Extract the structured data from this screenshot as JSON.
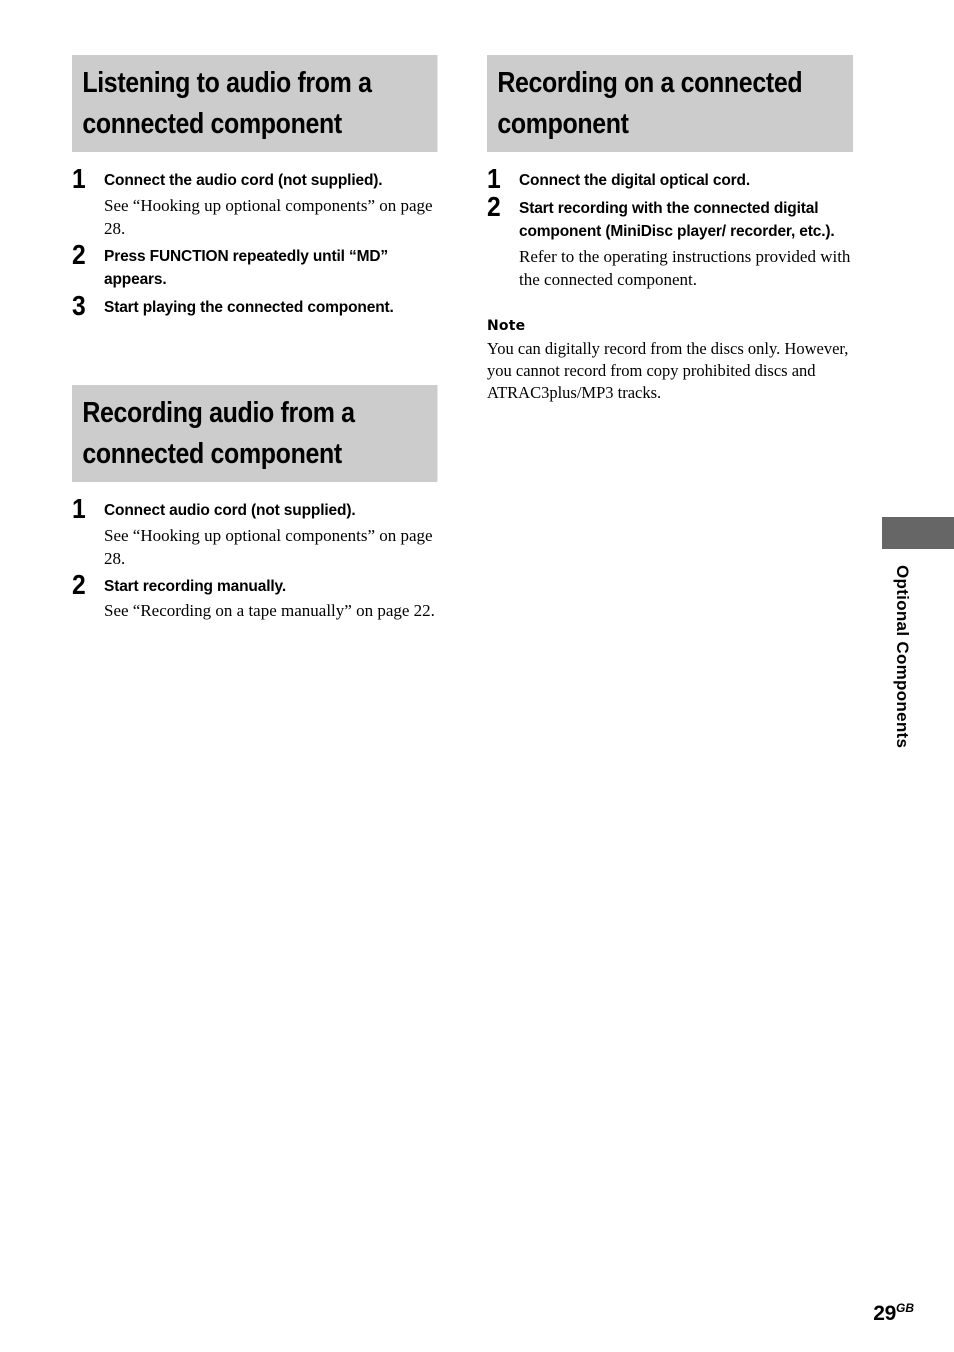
{
  "page": {
    "number": "29",
    "region_code": "GB",
    "side_tab_label": "Optional Components"
  },
  "left_column": {
    "sections": [
      {
        "heading": "Listening to audio from a connected component",
        "steps": [
          {
            "number": "1",
            "title": "Connect the audio cord (not supplied).",
            "body": "See “Hooking up optional components” on page 28."
          },
          {
            "number": "2",
            "title": "Press FUNCTION repeatedly until “MD” appears.",
            "body": ""
          },
          {
            "number": "3",
            "title": "Start playing the connected component.",
            "body": ""
          }
        ]
      },
      {
        "heading": "Recording audio from a connected component",
        "steps": [
          {
            "number": "1",
            "title": "Connect audio cord (not supplied).",
            "body": "See “Hooking up optional components” on page 28."
          },
          {
            "number": "2",
            "title": "Start recording manually.",
            "body": "See “Recording on a tape manually” on page 22."
          }
        ]
      }
    ]
  },
  "right_column": {
    "sections": [
      {
        "heading": "Recording on a connected component",
        "steps": [
          {
            "number": "1",
            "title": "Connect the digital optical cord.",
            "body": ""
          },
          {
            "number": "2",
            "title": "Start recording with the connected digital component (MiniDisc player/ recorder, etc.).",
            "body": "Refer to the operating instructions provided with the connected component."
          }
        ]
      }
    ],
    "note": {
      "heading": "Note",
      "body": "You can digitally record from the discs only. However, you cannot record from copy prohibited discs and ATRAC3plus/MP3 tracks."
    }
  },
  "colors": {
    "heading_bar": "#cccccc",
    "side_tab_block": "#666666",
    "text": "#000000",
    "page_background": "#ffffff"
  }
}
